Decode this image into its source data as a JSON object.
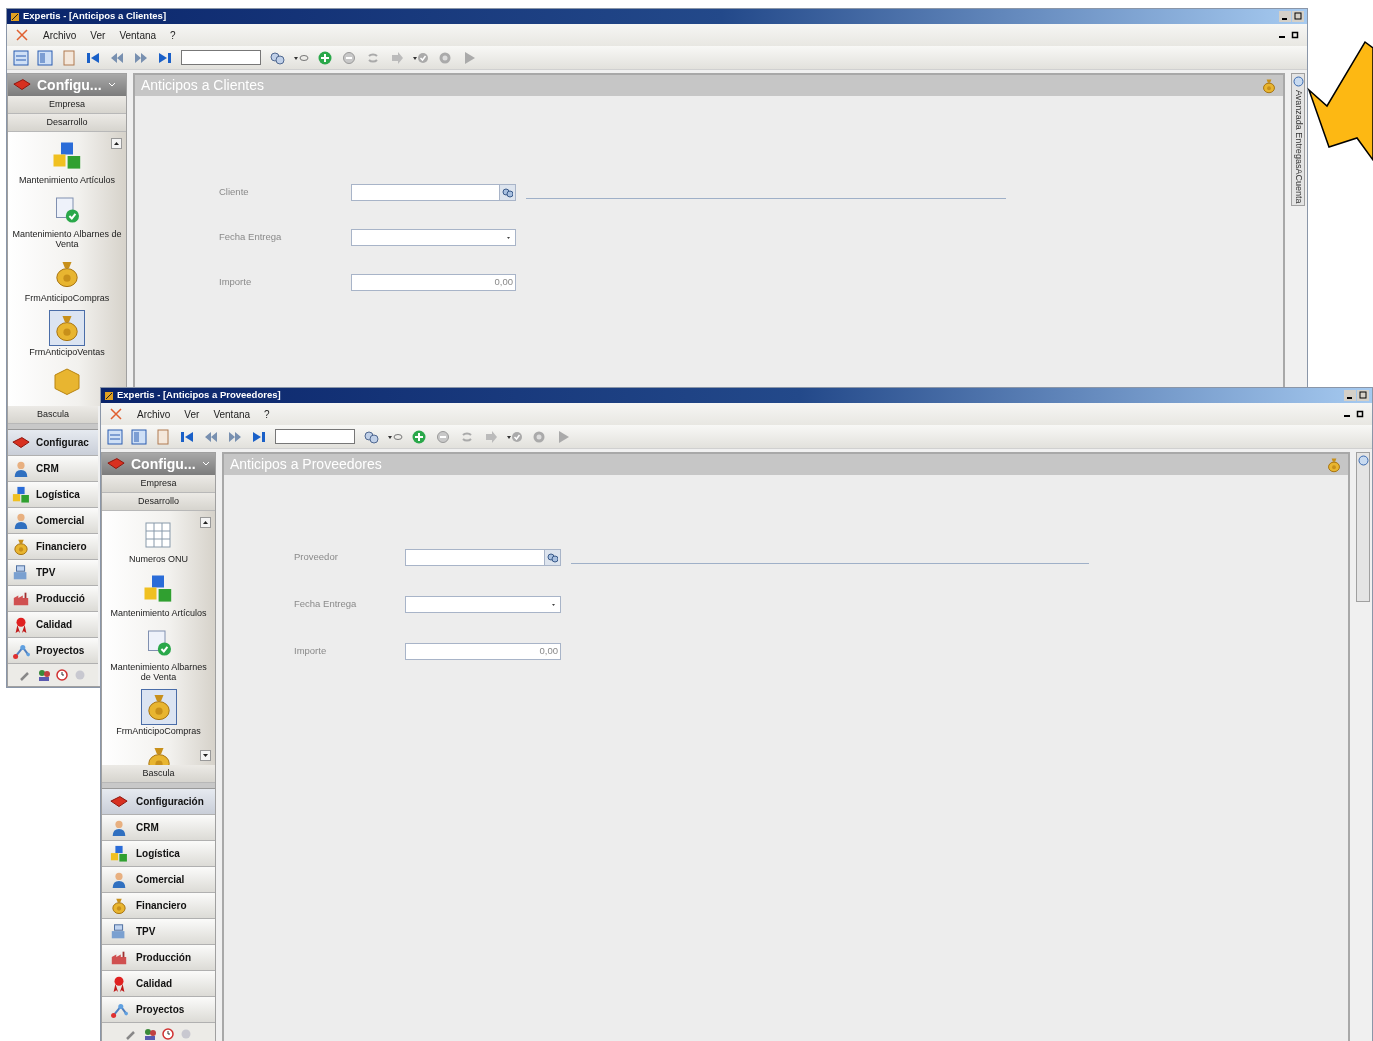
{
  "windows": [
    {
      "title": "Expertis - [Anticipos a Clientes]",
      "menu": [
        "Archivo",
        "Ver",
        "Ventana",
        "?"
      ],
      "nav": {
        "header": "Configu...",
        "groups": [
          "Empresa",
          "Desarrollo"
        ],
        "items": [
          {
            "kind": "cubes",
            "label": "Mantenimiento Artículos",
            "selected": false
          },
          {
            "kind": "document",
            "label": "Mantenimiento Albarnes de Venta",
            "selected": false
          },
          {
            "kind": "moneybag",
            "label": "FrmAnticipoCompras",
            "selected": false
          },
          {
            "kind": "moneybag",
            "label": "FrmAnticipoVentas",
            "selected": true
          },
          {
            "kind": "box",
            "selected": false
          }
        ],
        "footer_group": "Bascula",
        "modules": [
          {
            "kind": "book",
            "label": "Configurac",
            "selected": true
          },
          {
            "kind": "person",
            "label": "CRM",
            "selected": false
          },
          {
            "kind": "cubes",
            "label": "Logística",
            "selected": false
          },
          {
            "kind": "person",
            "label": "Comercial",
            "selected": false
          },
          {
            "kind": "moneybag",
            "label": "Financiero",
            "selected": false
          },
          {
            "kind": "register",
            "label": "TPV",
            "selected": false
          },
          {
            "kind": "factory",
            "label": "Producció",
            "selected": false
          },
          {
            "kind": "ribbon",
            "label": "Calidad",
            "selected": false
          },
          {
            "kind": "network",
            "label": "Proyectos",
            "selected": false
          }
        ]
      },
      "form": {
        "title": "Anticipos a Clientes",
        "fields": [
          {
            "kind": "lookup",
            "label": "Cliente"
          },
          {
            "kind": "date",
            "label": "Fecha Entrega"
          },
          {
            "kind": "number",
            "label": "Importe",
            "value": "0,00"
          }
        ]
      },
      "side_tab": "Avanzada EntregasACuenta"
    },
    {
      "title": "Expertis - [Anticipos a Proveedores]",
      "menu": [
        "Archivo",
        "Ver",
        "Ventana",
        "?"
      ],
      "nav": {
        "header": "Configu...",
        "groups": [
          "Empresa",
          "Desarrollo"
        ],
        "items": [
          {
            "kind": "grid",
            "label": "Numeros ONU",
            "selected": false
          },
          {
            "kind": "cubes",
            "label": "Mantenimiento Artículos",
            "selected": false
          },
          {
            "kind": "document",
            "label": "Mantenimiento Albarnes de Venta",
            "selected": false
          },
          {
            "kind": "moneybag",
            "label": "FrmAnticipoCompras",
            "selected": true
          },
          {
            "kind": "moneybag",
            "selected": false
          }
        ],
        "footer_group": "Bascula",
        "modules": [
          {
            "kind": "book",
            "label": "Configuración",
            "selected": true
          },
          {
            "kind": "person",
            "label": "CRM",
            "selected": false
          },
          {
            "kind": "cubes",
            "label": "Logística",
            "selected": false
          },
          {
            "kind": "person",
            "label": "Comercial",
            "selected": false
          },
          {
            "kind": "moneybag",
            "label": "Financiero",
            "selected": false
          },
          {
            "kind": "register",
            "label": "TPV",
            "selected": false
          },
          {
            "kind": "factory",
            "label": "Producción",
            "selected": false
          },
          {
            "kind": "ribbon",
            "label": "Calidad",
            "selected": false
          },
          {
            "kind": "network",
            "label": "Proyectos",
            "selected": false
          }
        ]
      },
      "form": {
        "title": "Anticipos a Proveedores",
        "fields": [
          {
            "kind": "lookup",
            "label": "Proveedor"
          },
          {
            "kind": "date",
            "label": "Fecha Entrega"
          },
          {
            "kind": "number",
            "label": "Importe",
            "value": "0,00"
          }
        ]
      }
    }
  ]
}
